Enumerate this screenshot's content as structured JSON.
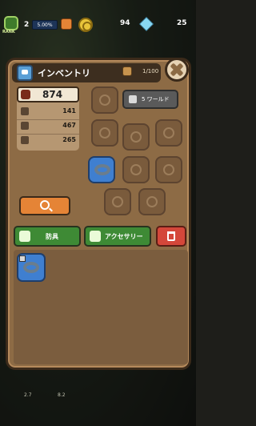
{
  "topbar": {
    "rank_label": "RANK",
    "level": "2",
    "xp_percent": "5.00%",
    "coins": "94",
    "gems": "25",
    "icons": [
      "rank-badge-icon",
      "plus-icon",
      "coin-icon",
      "gem-icon"
    ]
  },
  "inventory": {
    "title": "インベントリ",
    "capacity": "1/100",
    "power": "874",
    "stats": [
      {
        "icon": "sword-icon",
        "value": "141"
      },
      {
        "icon": "heart-icon",
        "value": "467"
      },
      {
        "icon": "plus-icon",
        "value": "265"
      }
    ],
    "world_button": "5 ワールド",
    "tabs": [
      {
        "label": "防具",
        "icon": "armor-icon"
      },
      {
        "label": "アクセサリー",
        "icon": "accessory-icon"
      }
    ]
  },
  "bottom": {
    "values": [
      "2.7",
      "8.2"
    ]
  },
  "colors": {
    "panel": "#8d6b45",
    "accent_orange": "#e58436",
    "tab_green": "#3e8a35",
    "trash_red": "#d4473a",
    "equipped_blue": "#3f7fd0"
  }
}
